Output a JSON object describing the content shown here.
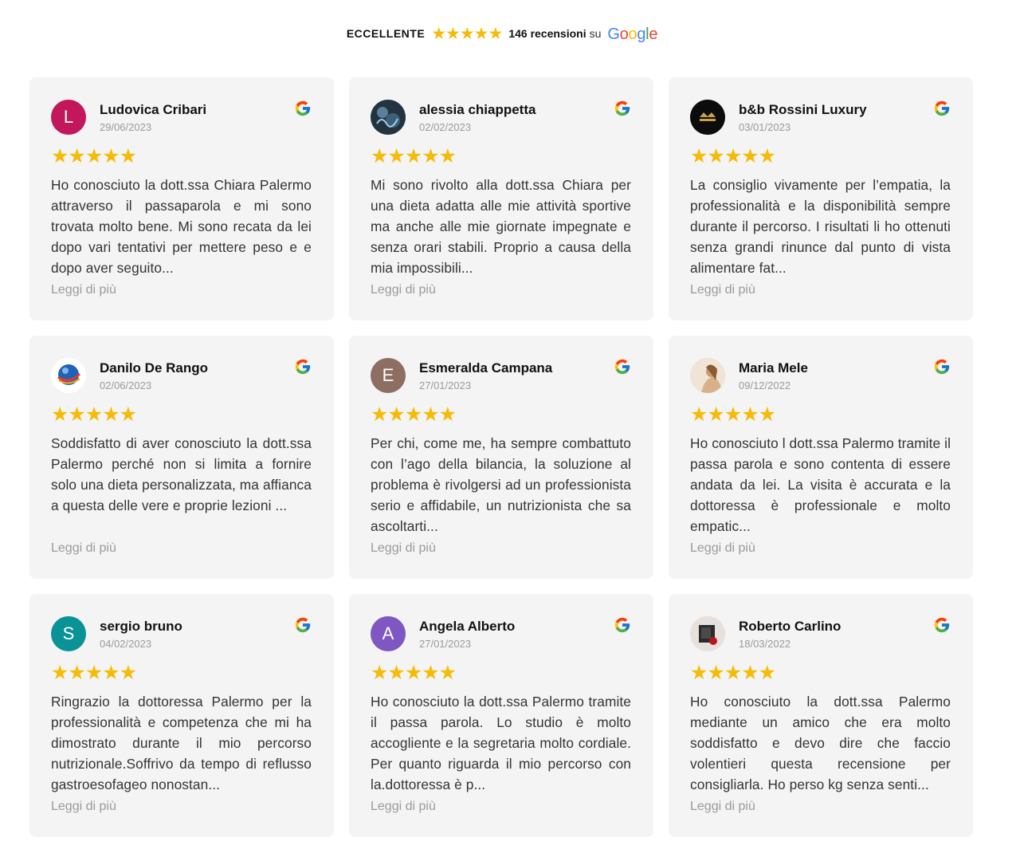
{
  "summary": {
    "rating_word": "ECCELLENTE",
    "stars": "★★★★★",
    "count_text": "146 recensioni",
    "on_text": "su",
    "provider": [
      "G",
      "o",
      "o",
      "g",
      "l",
      "e"
    ]
  },
  "colors": {
    "star": "#f6bb06",
    "card_bg": "#f4f4f4",
    "google_blue": "#4285F4",
    "google_red": "#EA4335",
    "google_yellow": "#FBBC05",
    "google_green": "#34A853"
  },
  "more_label": "Leggi di più",
  "reviews": [
    {
      "name": "Ludovica Cribari",
      "date": "29/06/2023",
      "stars": "★★★★★",
      "avatar_letter": "L",
      "avatar_color": "#c2185b",
      "avatar_type": "letter",
      "text": "Ho conosciuto la dott.ssa Chiara Palermo attraverso il passaparola e mi sono trovata molto bene. Mi sono recata da lei dopo vari tentativi per mettere peso e e dopo aver seguito..."
    },
    {
      "name": "alessia chiappetta",
      "date": "02/02/2023",
      "stars": "★★★★★",
      "avatar_letter": "",
      "avatar_color": "#2a3b4c",
      "avatar_type": "photo-plan",
      "text": "Mi sono rivolto alla dott.ssa Chiara per una dieta adatta alle mie attività sportive ma anche alle mie giornate impegnate e senza orari stabili. Proprio a causa della mia impossibili..."
    },
    {
      "name": "b&b Rossini Luxury",
      "date": "03/01/2023",
      "stars": "★★★★★",
      "avatar_letter": "",
      "avatar_color": "#111111",
      "avatar_type": "photo-logo",
      "text": "La consiglio vivamente per l’empatia, la professionalità e la disponibilità sempre durante il percorso. I risultati li ho ottenuti senza grandi rinunce dal punto di vista alimentare fat..."
    },
    {
      "name": "Danilo De Rango",
      "date": "02/06/2023",
      "stars": "★★★★★",
      "avatar_letter": "",
      "avatar_color": "#ffffff",
      "avatar_type": "photo-globe",
      "text": "Soddisfatto di aver conosciuto la dott.ssa Palermo perché non si limita a fornire solo una dieta personalizzata, ma affianca a questa delle vere e proprie lezioni ..."
    },
    {
      "name": "Esmeralda Campana",
      "date": "27/01/2023",
      "stars": "★★★★★",
      "avatar_letter": "E",
      "avatar_color": "#8d6e63",
      "avatar_type": "letter",
      "text": "Per chi, come me, ha sempre combattuto con l’ago della bilancia, la soluzione al problema è rivolgersi ad un professionista serio e affidabile, un nutrizionista che sa ascoltarti..."
    },
    {
      "name": "Maria Mele",
      "date": "09/12/2022",
      "stars": "★★★★★",
      "avatar_letter": "",
      "avatar_color": "#e8d9c8",
      "avatar_type": "photo-portrait",
      "text": "Ho conosciuto l dott.ssa Palermo tramite il passa parola e sono contenta di essere andata da lei. La visita è accurata e la dottoressa è professionale e molto empatic..."
    },
    {
      "name": "sergio bruno",
      "date": "04/02/2023",
      "stars": "★★★★★",
      "avatar_letter": "S",
      "avatar_color": "#0a9396",
      "avatar_type": "letter",
      "text": "Ringrazio la dottoressa Palermo per la professionalità e competenza che mi ha dimostrato durante il mio percorso nutrizionale.Soffrivo da tempo di reflusso gastroesofageo nonostan..."
    },
    {
      "name": "Angela Alberto",
      "date": "27/01/2023",
      "stars": "★★★★★",
      "avatar_letter": "A",
      "avatar_color": "#7e57c2",
      "avatar_type": "letter",
      "text": "Ho conosciuto la dott.ssa Palermo tramite il passa parola. Lo studio è molto accogliente e la segretaria molto cordiale. Per quanto riguarda il mio percorso con la.dottoressa è p..."
    },
    {
      "name": "Roberto Carlino",
      "date": "18/03/2022",
      "stars": "★★★★★",
      "avatar_letter": "",
      "avatar_color": "#d9d4cf",
      "avatar_type": "photo-object",
      "text": "Ho conosciuto la dott.ssa Palermo mediante un amico che era molto soddisfatto e devo dire che faccio volentieri questa recensione per consigliarla. Ho perso kg senza senti..."
    }
  ]
}
